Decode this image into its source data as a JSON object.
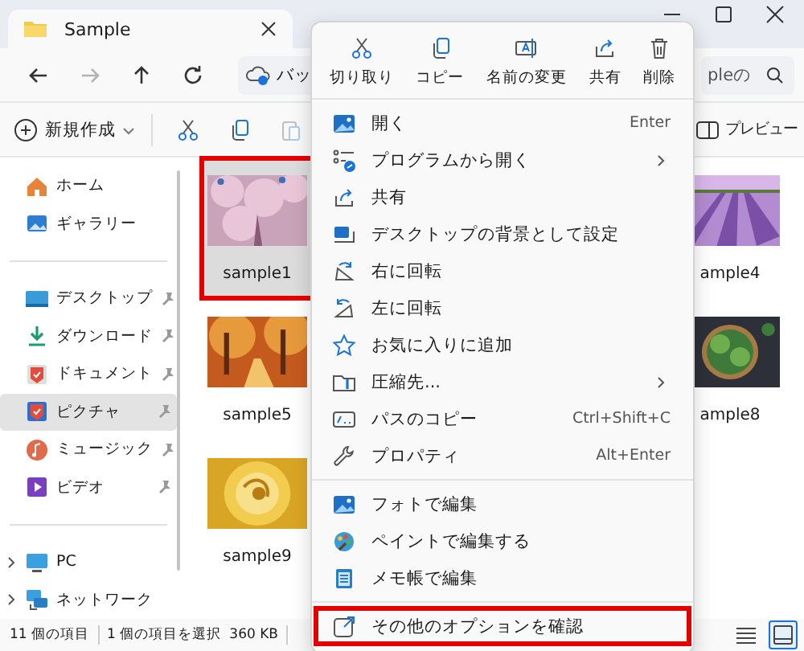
{
  "window": {
    "title": "Sample"
  },
  "nav_buttons": [
    {
      "kind": "back",
      "disabled": false
    },
    {
      "kind": "forward",
      "disabled": true
    },
    {
      "kind": "up",
      "disabled": false
    },
    {
      "kind": "refresh",
      "disabled": false
    }
  ],
  "address": {
    "value": "バッ"
  },
  "search": {
    "placeholder": "pleの"
  },
  "toolbar": {
    "new_label": "新規作成",
    "buttons": [
      {
        "kind": "cut",
        "disabled": false
      },
      {
        "kind": "copy",
        "disabled": false
      },
      {
        "kind": "paste",
        "disabled": true
      }
    ],
    "preview_label": "プレビュー"
  },
  "sidebar": {
    "sections": [
      [
        {
          "kind": "home",
          "label": "ホーム",
          "pinned": false,
          "selected": false
        },
        {
          "kind": "gallery",
          "label": "ギャラリー",
          "pinned": false,
          "selected": false
        }
      ],
      [
        {
          "kind": "desktop",
          "label": "デスクトップ",
          "pinned": true,
          "selected": false
        },
        {
          "kind": "download",
          "label": "ダウンロード",
          "pinned": true,
          "selected": false
        },
        {
          "kind": "documents",
          "label": "ドキュメント",
          "pinned": true,
          "selected": false
        },
        {
          "kind": "pictures",
          "label": "ピクチャ",
          "pinned": true,
          "selected": true
        },
        {
          "kind": "music",
          "label": "ミュージック",
          "pinned": true,
          "selected": false
        },
        {
          "kind": "video",
          "label": "ビデオ",
          "pinned": true,
          "selected": false
        }
      ],
      [
        {
          "kind": "pc",
          "label": "PC",
          "pinned": false,
          "selected": false,
          "expanded": false
        },
        {
          "kind": "network",
          "label": "ネットワーク",
          "pinned": false,
          "selected": false,
          "expanded": false
        }
      ]
    ]
  },
  "files": [
    {
      "name": "sample1",
      "selected": true,
      "highlighted": true
    },
    {
      "name": "ample4",
      "selected": false,
      "highlighted": false
    },
    {
      "name": "sample5",
      "selected": false,
      "highlighted": false
    },
    {
      "name": "ample8",
      "selected": false,
      "highlighted": false
    },
    {
      "name": "sample9",
      "selected": false,
      "highlighted": false
    }
  ],
  "context_menu": {
    "actions": [
      {
        "kind": "cut",
        "label": "切り取り"
      },
      {
        "kind": "copy",
        "label": "コピー"
      },
      {
        "kind": "rename",
        "label": "名前の変更"
      },
      {
        "kind": "share",
        "label": "共有"
      },
      {
        "kind": "delete",
        "label": "削除"
      }
    ],
    "sections": [
      [
        {
          "kind": "open",
          "label": "開く",
          "shortcut": "Enter",
          "submenu": false,
          "highlighted": false
        },
        {
          "kind": "openwith",
          "label": "プログラムから開く",
          "submenu": true,
          "highlighted": false
        },
        {
          "kind": "share",
          "label": "共有",
          "submenu": false,
          "highlighted": false
        },
        {
          "kind": "wallpaper",
          "label": "デスクトップの背景として設定",
          "submenu": false,
          "highlighted": false
        },
        {
          "kind": "rotright",
          "label": "右に回転",
          "submenu": false,
          "highlighted": false
        },
        {
          "kind": "rotleft",
          "label": "左に回転",
          "submenu": false,
          "highlighted": false
        },
        {
          "kind": "star",
          "label": "お気に入りに追加",
          "submenu": false,
          "highlighted": false
        },
        {
          "kind": "zip",
          "label": "圧縮先...",
          "submenu": true,
          "highlighted": false
        },
        {
          "kind": "path",
          "label": "パスのコピー",
          "shortcut": "Ctrl+Shift+C",
          "submenu": false,
          "highlighted": false
        },
        {
          "kind": "properties",
          "label": "プロパティ",
          "shortcut": "Alt+Enter",
          "submenu": false,
          "highlighted": false
        }
      ],
      [
        {
          "kind": "photos",
          "label": "フォトで編集",
          "submenu": false,
          "highlighted": false
        },
        {
          "kind": "paint",
          "label": "ペイントで編集する",
          "submenu": false,
          "highlighted": false
        },
        {
          "kind": "notepad",
          "label": "メモ帳で編集",
          "submenu": false,
          "highlighted": false
        }
      ],
      [
        {
          "kind": "more",
          "label": "その他のオプションを確認",
          "submenu": false,
          "highlighted": true
        }
      ]
    ]
  },
  "status_bar": {
    "item_count": "11 個の項目",
    "selection": "1 個の項目を選択",
    "size": "360 KB"
  },
  "view_buttons": [
    {
      "kind": "details",
      "selected": false
    },
    {
      "kind": "tiles",
      "selected": true
    }
  ]
}
